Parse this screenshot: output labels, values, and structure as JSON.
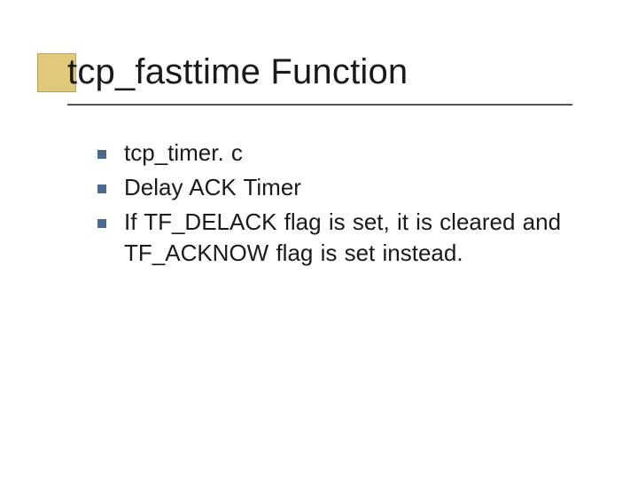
{
  "title": "tcp_fasttime Function",
  "bullets": {
    "b0": "tcp_timer. c",
    "b1": "Delay ACK Timer",
    "b2": "If TF_DELACK flag is set, it is cleared and TF_ACKNOW flag is set instead."
  }
}
